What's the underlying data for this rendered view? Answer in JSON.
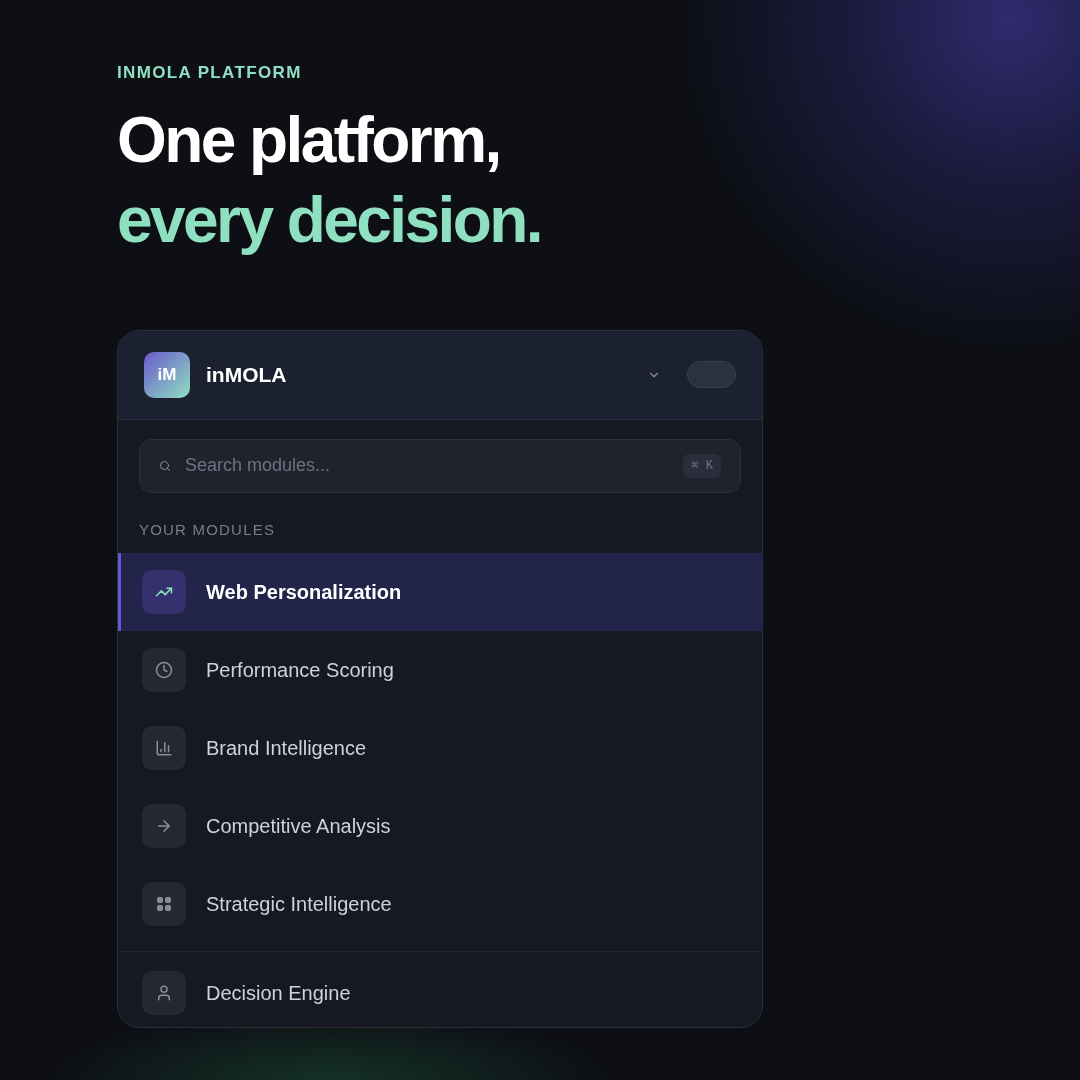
{
  "hero": {
    "eyebrow": "INMOLA PLATFORM",
    "title_line_1": "One platform,",
    "title_line_2": "every decision."
  },
  "panel": {
    "logo": "iM",
    "brand": "inMOLA",
    "search": {
      "placeholder": "Search modules...",
      "shortcut": "⌘ K"
    },
    "section_label": "YOUR MODULES",
    "modules": [
      {
        "label": "Web Personalization",
        "selected": true
      },
      {
        "label": "Performance Scoring",
        "selected": false
      },
      {
        "label": "Brand Intelligence",
        "selected": false
      },
      {
        "label": "Competitive Analysis",
        "selected": false
      },
      {
        "label": "Strategic Intelligence",
        "selected": false
      }
    ],
    "footer_item": {
      "label": "Decision Engine",
      "selected": false
    }
  }
}
